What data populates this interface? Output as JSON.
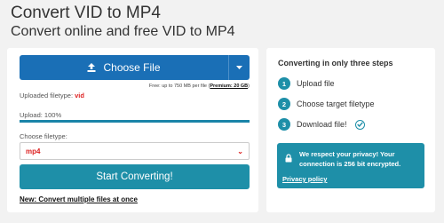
{
  "header": {
    "title": "Convert VID to MP4",
    "subtitle": "Convert online and free VID to MP4"
  },
  "converter": {
    "step1": "1.",
    "step2": "2.",
    "step3": "3.",
    "choose_file_label": "Choose File",
    "limit_text": "Free: up to 750 MB per file (",
    "limit_link": "Premium: 20 GB",
    "limit_close": ")",
    "uploaded_filetype_label": "Uploaded filetype: ",
    "uploaded_filetype_value": "vid",
    "upload_status": "Upload: 100%",
    "upload_progress": 1.0,
    "choose_filetype_label": "Choose filetype:",
    "selected_filetype": "mp4",
    "start_button": "Start Converting!",
    "multi_link": "New: Convert multiple files at once"
  },
  "steps_panel": {
    "title": "Converting in only three steps",
    "steps": [
      {
        "num": "1",
        "label": "Upload file"
      },
      {
        "num": "2",
        "label": "Choose target filetype"
      },
      {
        "num": "3",
        "label": "Download file!"
      }
    ],
    "privacy_text": "We respect your privacy! Your connection is 256 bit encrypted.",
    "privacy_link": "Privacy policy"
  },
  "icons": {
    "upload": "upload-icon",
    "dropdown": "caret-down-icon",
    "select_chevron": "chevron-down-icon",
    "check": "check-circle-icon",
    "lock": "lock-icon"
  },
  "colors": {
    "primary_blue": "#1a6fb6",
    "teal": "#1e8fa8",
    "accent_red": "#e01e1e",
    "background": "#f2f2f2"
  }
}
